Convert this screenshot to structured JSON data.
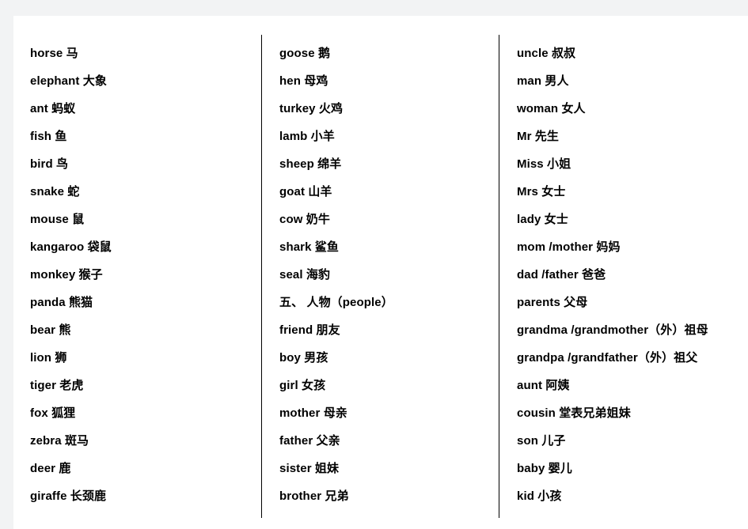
{
  "page": {
    "background_color": "#ffffff",
    "canvas_color": "#f2f3f4",
    "text_color": "#000000",
    "divider_color": "#000000"
  },
  "columns": [
    {
      "name": "column-1-animals",
      "entries": [
        {
          "text": "horse 马",
          "type": "entry"
        },
        {
          "text": "elephant 大象",
          "type": "entry"
        },
        {
          "text": "ant 蚂蚁",
          "type": "entry"
        },
        {
          "text": "fish 鱼",
          "type": "entry"
        },
        {
          "text": "bird 鸟",
          "type": "entry"
        },
        {
          "text": "snake 蛇",
          "type": "entry"
        },
        {
          "text": "mouse 鼠",
          "type": "entry"
        },
        {
          "text": "kangaroo 袋鼠",
          "type": "entry"
        },
        {
          "text": "monkey 猴子",
          "type": "entry"
        },
        {
          "text": "panda 熊猫",
          "type": "entry"
        },
        {
          "text": "bear 熊",
          "type": "entry"
        },
        {
          "text": "lion 狮",
          "type": "entry"
        },
        {
          "text": "tiger 老虎",
          "type": "entry"
        },
        {
          "text": "fox 狐狸",
          "type": "entry"
        },
        {
          "text": "zebra 斑马",
          "type": "entry"
        },
        {
          "text": "deer 鹿",
          "type": "entry"
        },
        {
          "text": "giraffe 长颈鹿",
          "type": "entry"
        }
      ]
    },
    {
      "name": "column-2-animals-people",
      "entries": [
        {
          "text": "goose 鹅",
          "type": "entry"
        },
        {
          "text": "hen 母鸡",
          "type": "entry"
        },
        {
          "text": "turkey 火鸡",
          "type": "entry"
        },
        {
          "text": "lamb 小羊",
          "type": "entry"
        },
        {
          "text": "sheep 绵羊",
          "type": "entry"
        },
        {
          "text": "goat 山羊",
          "type": "entry"
        },
        {
          "text": "cow 奶牛",
          "type": "entry"
        },
        {
          "text": "shark 鲨鱼",
          "type": "entry"
        },
        {
          "text": "seal 海豹",
          "type": "entry"
        },
        {
          "text": "五、 人物（people）",
          "type": "heading"
        },
        {
          "text": "friend 朋友",
          "type": "entry"
        },
        {
          "text": "boy 男孩",
          "type": "entry"
        },
        {
          "text": "girl 女孩",
          "type": "entry"
        },
        {
          "text": "mother 母亲",
          "type": "entry"
        },
        {
          "text": "father 父亲",
          "type": "entry"
        },
        {
          "text": "sister 姐妹",
          "type": "entry"
        },
        {
          "text": "brother 兄弟",
          "type": "entry"
        }
      ]
    },
    {
      "name": "column-3-people",
      "entries": [
        {
          "text": "uncle 叔叔",
          "type": "entry"
        },
        {
          "text": "man 男人",
          "type": "entry"
        },
        {
          "text": "woman 女人",
          "type": "entry"
        },
        {
          "text": "Mr  先生",
          "type": "entry"
        },
        {
          "text": "Miss 小姐",
          "type": "entry"
        },
        {
          "text": "Mrs  女士",
          "type": "entry"
        },
        {
          "text": "lady 女士",
          "type": "entry"
        },
        {
          "text": "mom /mother 妈妈",
          "type": "entry"
        },
        {
          "text": "dad /father 爸爸",
          "type": "entry"
        },
        {
          "text": "parents 父母",
          "type": "entry"
        },
        {
          "text": "grandma /grandmother（外）祖母",
          "type": "entry"
        },
        {
          "text": "grandpa /grandfather（外）祖父",
          "type": "entry"
        },
        {
          "text": "aunt 阿姨",
          "type": "entry"
        },
        {
          "text": "cousin 堂表兄弟姐妹",
          "type": "entry"
        },
        {
          "text": "son 儿子",
          "type": "entry"
        },
        {
          "text": "baby 婴儿",
          "type": "entry"
        },
        {
          "text": "kid 小孩",
          "type": "entry"
        }
      ]
    }
  ]
}
